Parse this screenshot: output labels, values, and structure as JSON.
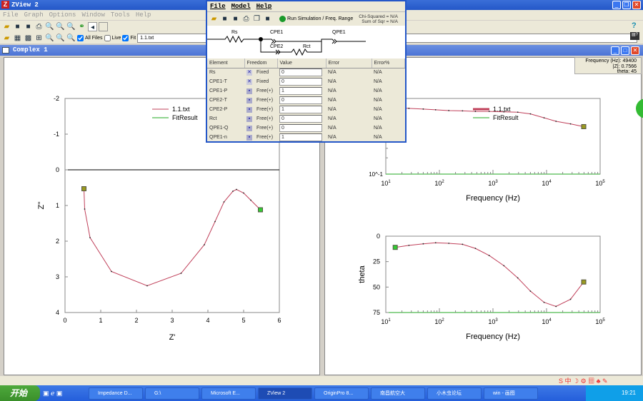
{
  "app": {
    "title": "ZView 2",
    "menu": [
      "File",
      "Graph",
      "Options",
      "Window",
      "Tools",
      "Help"
    ]
  },
  "toolbar": {
    "all_files_label": "All Files",
    "live_label": "Live",
    "fit_label": "Fit",
    "file_value": "1.1.txt",
    "all_files_checked": true,
    "live_checked": false,
    "fit_checked": true,
    "help_icon": "?"
  },
  "child": {
    "title": "Complex 1"
  },
  "tooltip": {
    "line1": "Frequency (Hz): 49400",
    "line2": "|Z|: 0.7566",
    "line3": "theta: 45"
  },
  "dialog": {
    "menu": [
      "File",
      "Model",
      "Help"
    ],
    "run_label": "Run Simulation / Freq. Range",
    "chi_label": "Chi-Squared = N/A",
    "sum_label": "Sum of Sqr  = N/A",
    "circuit": {
      "rs": "Rs",
      "cpe1": "CPE1",
      "cpe2": "CPE2",
      "rct": "Rct",
      "qpe1": "QPE1"
    },
    "columns": [
      "Element",
      "Freedom",
      "Value",
      "Error",
      "Error%"
    ],
    "rows": [
      {
        "element": "Rs",
        "freedom": "Fixed",
        "value": "0",
        "error": "N/A",
        "error_pct": "N/A",
        "fixed": true
      },
      {
        "element": "CPE1-T",
        "freedom": "Fixed",
        "value": "0",
        "error": "N/A",
        "error_pct": "N/A",
        "fixed": true
      },
      {
        "element": "CPE1-P",
        "freedom": "Free(+)",
        "value": "1",
        "error": "N/A",
        "error_pct": "N/A",
        "fixed": false
      },
      {
        "element": "CPE2-T",
        "freedom": "Free(+)",
        "value": "0",
        "error": "N/A",
        "error_pct": "N/A",
        "fixed": false
      },
      {
        "element": "CPE2-P",
        "freedom": "Free(+)",
        "value": "1",
        "error": "N/A",
        "error_pct": "N/A",
        "fixed": false
      },
      {
        "element": "Rct",
        "freedom": "Free(+)",
        "value": "0",
        "error": "N/A",
        "error_pct": "N/A",
        "fixed": false
      },
      {
        "element": "QPE1-Q",
        "freedom": "Free(+)",
        "value": "0",
        "error": "N/A",
        "error_pct": "N/A",
        "fixed": false
      },
      {
        "element": "QPE1-n",
        "freedom": "Free(+)",
        "value": "1",
        "error": "N/A",
        "error_pct": "N/A",
        "fixed": false
      }
    ]
  },
  "taskbar": {
    "start": "开始",
    "tasks": [
      "Impedance D...",
      "G:\\",
      "Microsoft E...",
      "ZView 2",
      "OriginPro 8...",
      "南昌航空大",
      "小木虫论坛",
      "win - 画图"
    ],
    "clock": "19:21"
  },
  "chart_data": [
    {
      "type": "line",
      "title": "",
      "xlabel": "Z'",
      "ylabel": "Z''",
      "xlim": [
        0,
        6
      ],
      "ylim": [
        -2,
        4
      ],
      "xticks": [
        "0",
        "1",
        "2",
        "3",
        "4",
        "5",
        "6"
      ],
      "yticks": [
        "-2",
        "-1",
        "0",
        "1",
        "2",
        "3",
        "4"
      ],
      "legend": [
        "1.1.txt",
        "FitResult"
      ],
      "legend_position": "top-right",
      "x": [
        0.53,
        0.55,
        0.7,
        1.3,
        2.3,
        3.25,
        3.9,
        4.2,
        4.45,
        4.7,
        4.8,
        5.0,
        5.2,
        5.47
      ],
      "y": [
        0.53,
        1.1,
        1.9,
        2.85,
        3.25,
        2.9,
        2.1,
        1.45,
        0.9,
        0.6,
        0.55,
        0.65,
        0.85,
        1.12
      ]
    },
    {
      "type": "line",
      "xlabel": "Frequency (Hz)",
      "ylabel": "|Z|",
      "xscale": "log",
      "xlim": [
        10,
        100000
      ],
      "ylim_log10": [
        -1,
        0.4
      ],
      "xticks": [
        "10^1",
        "10^2",
        "10^3",
        "10^4",
        "10^5"
      ],
      "ytick_bottom": "10^-1",
      "legend": [
        "1.1.txt",
        "FitResult"
      ],
      "x": [
        15,
        27,
        50,
        85,
        150,
        270,
        470,
        850,
        1600,
        2900,
        5000,
        9000,
        15000,
        28000,
        49400
      ],
      "y": [
        1.7,
        1.65,
        1.6,
        1.55,
        1.5,
        1.48,
        1.45,
        1.45,
        1.42,
        1.4,
        1.3,
        1.1,
        0.95,
        0.85,
        0.7566
      ]
    },
    {
      "type": "line",
      "xlabel": "Frequency (Hz)",
      "ylabel": "theta",
      "xscale": "log",
      "xlim": [
        10,
        100000
      ],
      "ylim": [
        0,
        75
      ],
      "xticks": [
        "10^1",
        "10^2",
        "10^3",
        "10^4",
        "10^5"
      ],
      "yticks": [
        "0",
        "25",
        "50",
        "75"
      ],
      "x": [
        15,
        27,
        50,
        85,
        150,
        270,
        470,
        850,
        1600,
        2900,
        5000,
        9000,
        15000,
        28000,
        49400
      ],
      "y": [
        11,
        9,
        7.5,
        6.5,
        7,
        8,
        12,
        19,
        29,
        41,
        54,
        65,
        69,
        62,
        45
      ]
    }
  ]
}
